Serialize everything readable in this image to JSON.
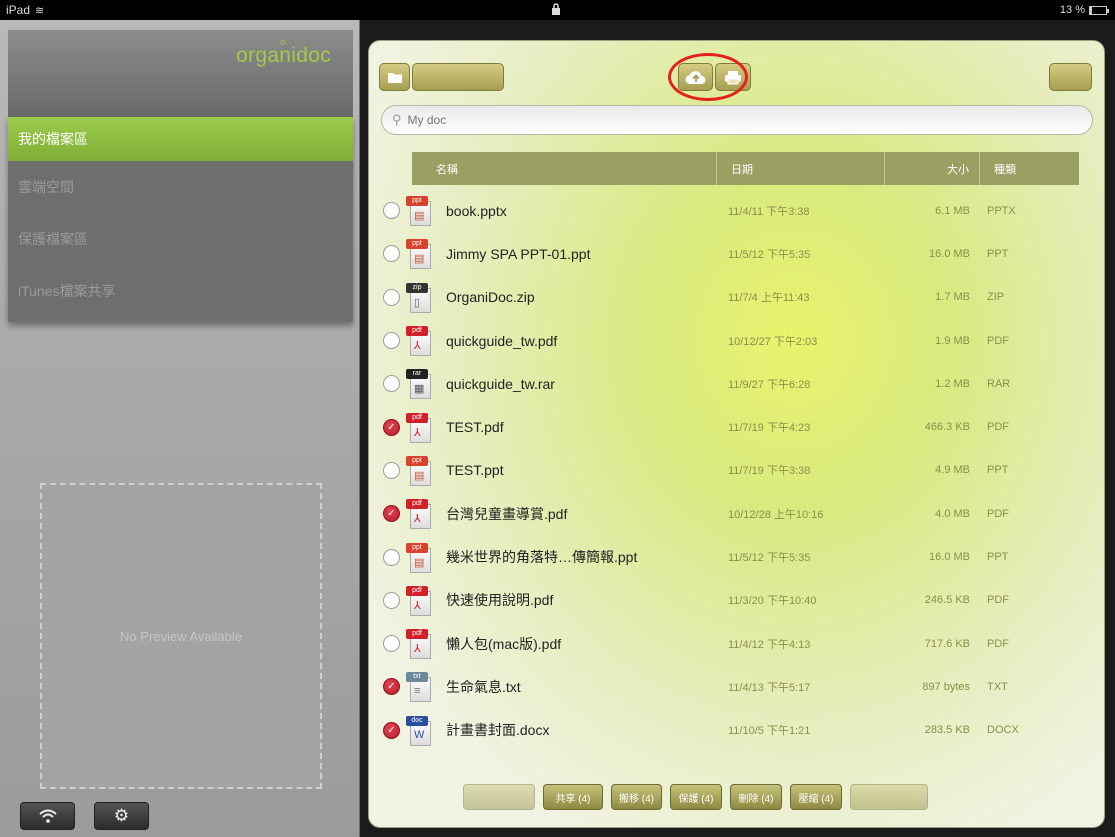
{
  "status_bar": {
    "device": "iPad",
    "battery": "13 %"
  },
  "sidebar": {
    "brand": "organidoc",
    "items": [
      {
        "label": "我的檔案區",
        "active": true
      },
      {
        "label": "雲端空間",
        "active": false
      },
      {
        "label": "保護檔案區",
        "active": false
      },
      {
        "label": "iTunes檔案共享",
        "active": false
      }
    ],
    "preview_text": "No Preview Available"
  },
  "toolbar": {
    "new_folder_label": "",
    "edit_label": "",
    "upload_icon": "cloud-upload-icon",
    "print_icon": "printer-icon",
    "done_label": ""
  },
  "search": {
    "placeholder": "My doc"
  },
  "columns": {
    "name": "名稱",
    "date": "日期",
    "size": "大小",
    "type": "種類"
  },
  "files": [
    {
      "name": "book.pptx",
      "date": "11/4/11 下午3:38",
      "size": "6.1 MB",
      "type": "PPTX",
      "kind": "ppt",
      "checked": false
    },
    {
      "name": "Jimmy SPA PPT-01.ppt",
      "date": "11/5/12 下午5:35",
      "size": "16.0 MB",
      "type": "PPT",
      "kind": "ppt",
      "checked": false
    },
    {
      "name": "OrganiDoc.zip",
      "date": "11/7/4 上午11:43",
      "size": "1.7 MB",
      "type": "ZIP",
      "kind": "zip",
      "checked": false
    },
    {
      "name": "quickguide_tw.pdf",
      "date": "10/12/27 下午2:03",
      "size": "1.9 MB",
      "type": "PDF",
      "kind": "pdf",
      "checked": false
    },
    {
      "name": "quickguide_tw.rar",
      "date": "11/9/27 下午6:28",
      "size": "1.2 MB",
      "type": "RAR",
      "kind": "rar",
      "checked": false
    },
    {
      "name": "TEST.pdf",
      "date": "11/7/19 下午4:23",
      "size": "466.3 KB",
      "type": "PDF",
      "kind": "pdf",
      "checked": true
    },
    {
      "name": "TEST.ppt",
      "date": "11/7/19 下午3:38",
      "size": "4.9 MB",
      "type": "PPT",
      "kind": "ppt",
      "checked": false
    },
    {
      "name": "台灣兒童畫導賞.pdf",
      "date": "10/12/28 上午10:16",
      "size": "4.0 MB",
      "type": "PDF",
      "kind": "pdf",
      "checked": true
    },
    {
      "name": "幾米世界的角落特…傳簡報.ppt",
      "date": "11/5/12 下午5:35",
      "size": "16.0 MB",
      "type": "PPT",
      "kind": "ppt",
      "checked": false
    },
    {
      "name": "快速使用說明.pdf",
      "date": "11/3/20 下午10:40",
      "size": "246.5 KB",
      "type": "PDF",
      "kind": "pdf",
      "checked": false
    },
    {
      "name": "懶人包(mac版).pdf",
      "date": "11/4/12 下午4:13",
      "size": "717.6 KB",
      "type": "PDF",
      "kind": "pdf",
      "checked": false
    },
    {
      "name": "生命氣息.txt",
      "date": "11/4/13 下午5:17",
      "size": "897 bytes",
      "type": "TXT",
      "kind": "txt",
      "checked": true
    },
    {
      "name": "計畫書封面.docx",
      "date": "11/10/5 下午1:21",
      "size": "283.5 KB",
      "type": "DOCX",
      "kind": "doc",
      "checked": true
    }
  ],
  "actions": [
    {
      "label": "",
      "disabled": true
    },
    {
      "label": "共享 (4)",
      "disabled": false
    },
    {
      "label": "搬移 (4)",
      "disabled": false
    },
    {
      "label": "保護 (4)",
      "disabled": false
    },
    {
      "label": "刪除 (4)",
      "disabled": false
    },
    {
      "label": "壓縮 (4)",
      "disabled": false
    },
    {
      "label": "",
      "disabled": true
    }
  ],
  "colors": {
    "accent_green": "#8fbe41",
    "highlight_red": "#e3201c",
    "checked_red": "#c0202e"
  }
}
